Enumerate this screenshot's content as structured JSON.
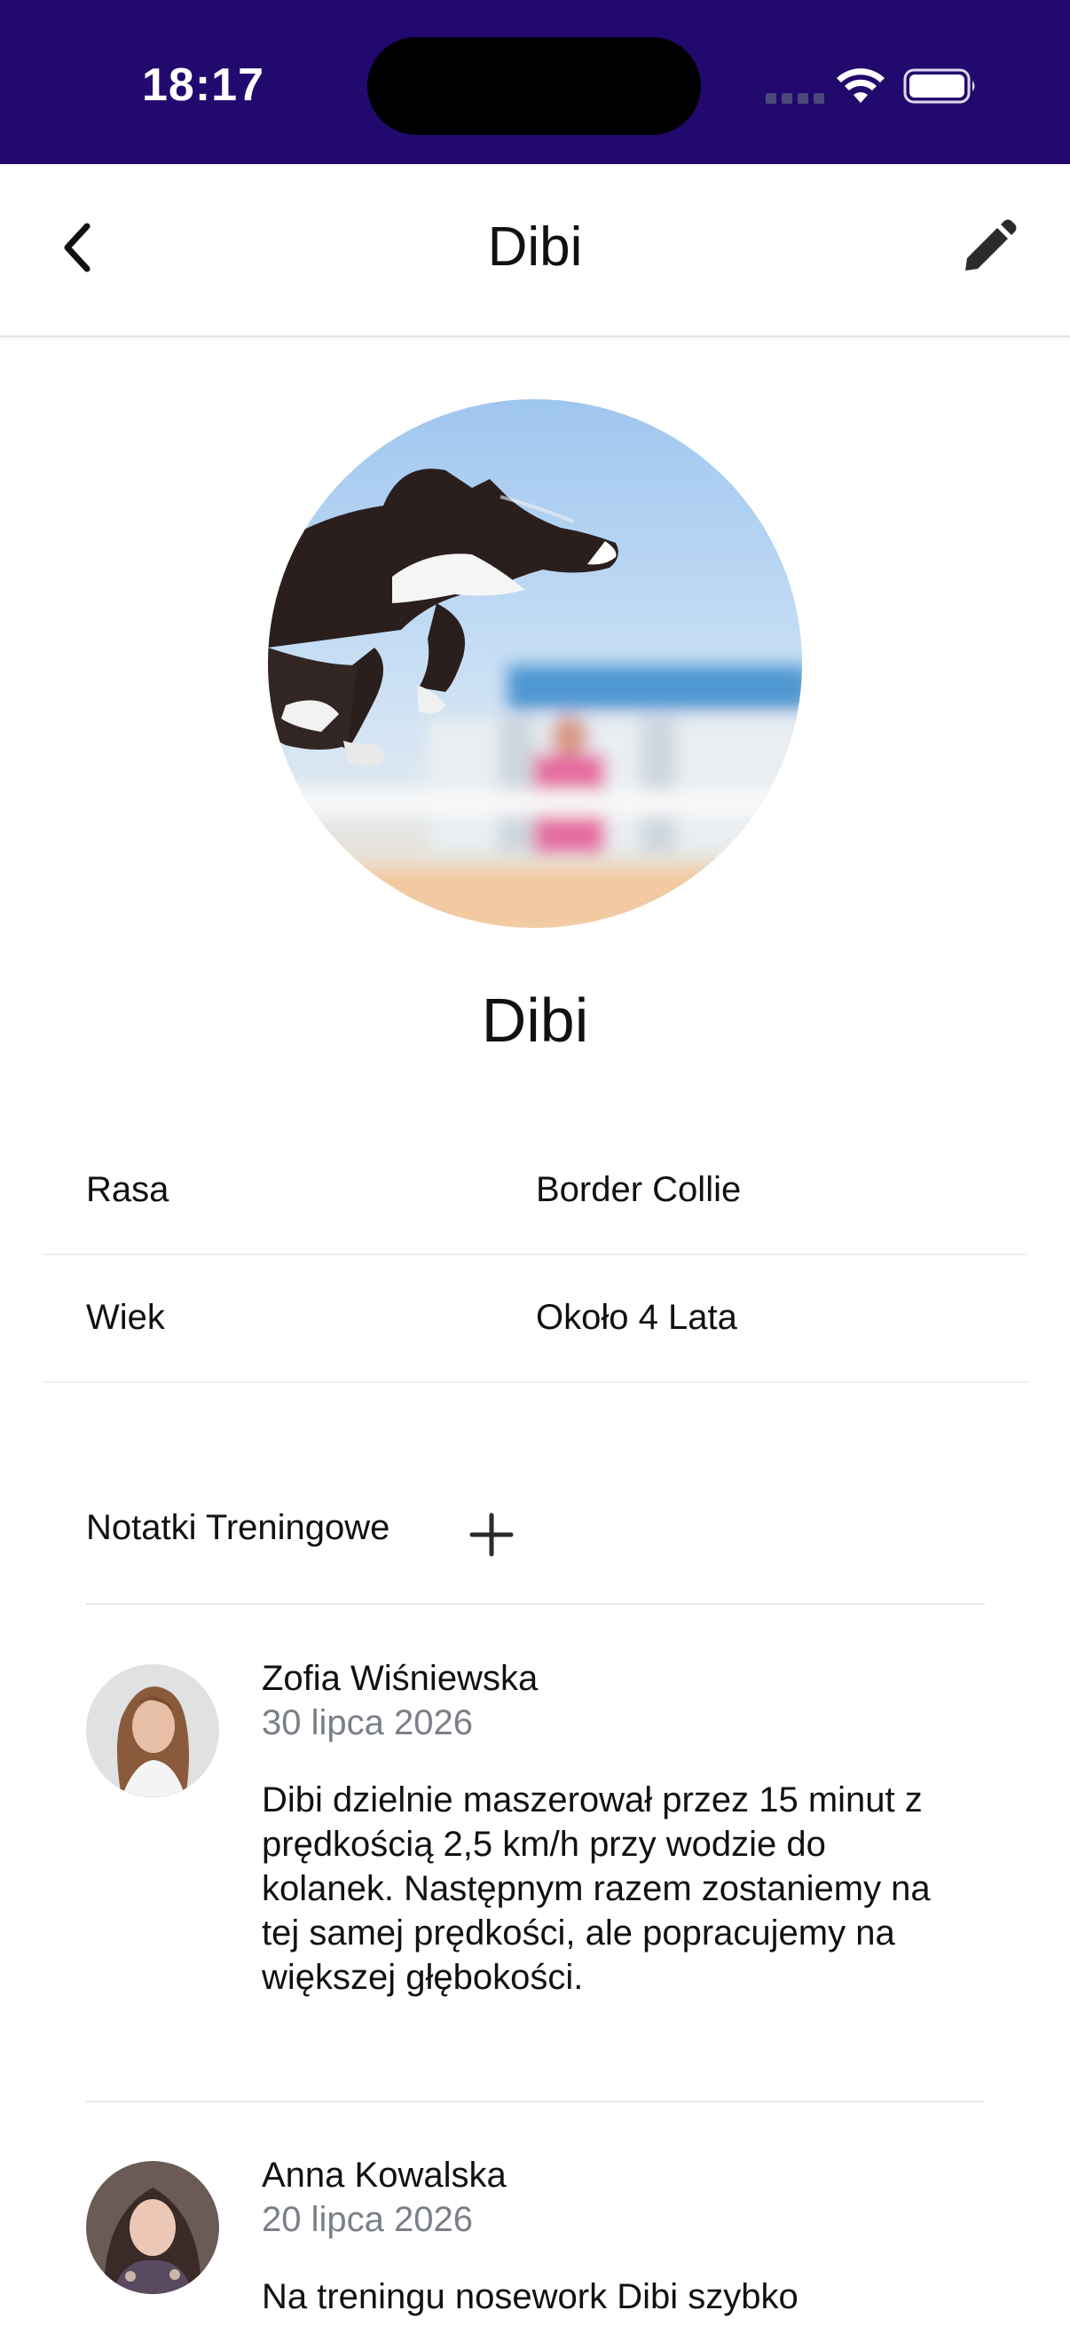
{
  "status_bar": {
    "time": "18:17"
  },
  "nav": {
    "title": "Dibi",
    "back_icon": "chevron-left-icon",
    "edit_icon": "pencil-icon"
  },
  "profile": {
    "name": "Dibi",
    "photo": "dog-photo"
  },
  "details": [
    {
      "label": "Rasa",
      "value": "Border Collie"
    },
    {
      "label": "Wiek",
      "value": "Około 4 Lata"
    }
  ],
  "notes": {
    "title": "Notatki Treningowe",
    "add_icon": "plus-icon",
    "items": [
      {
        "author": "Zofia Wiśniewska",
        "date": "30 lipca 2026",
        "text": "Dibi dzielnie maszerował przez 15 minut z prędkością 2,5 km/h przy wodzie do kolanek. Następnym razem zostaniemy na tej samej prędkości, ale popracujemy na większej głębokości."
      },
      {
        "author": "Anna Kowalska",
        "date": "20 lipca 2026",
        "text": "Na treningu nosework Dibi szybko"
      }
    ]
  },
  "colors": {
    "status_bar": "#22096e",
    "date_text": "#7a7f88"
  }
}
